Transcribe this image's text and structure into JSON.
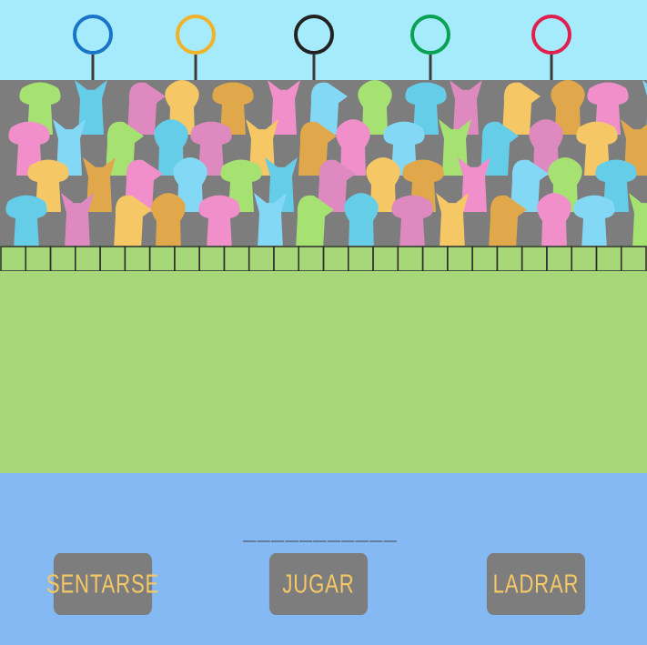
{
  "colors": {
    "sky": "#a6ebfb",
    "stands": "#7d7d7d",
    "field": "#a6d779",
    "water": "#84b9f4",
    "rail_stroke": "#2c2c2c",
    "button_bg": "#7d7d7d",
    "button_text": "#f6c765",
    "dogs": [
      "#a5e272",
      "#f08fca",
      "#f6c765",
      "#66cde9",
      "#83d9f5",
      "#e0a84a",
      "#de8ac0"
    ]
  },
  "rings": [
    {
      "color": "#1a74c7"
    },
    {
      "color": "#f0b229"
    },
    {
      "color": "#222222"
    },
    {
      "color": "#09a153"
    },
    {
      "color": "#e01f4f"
    }
  ],
  "answer_blank": "___________",
  "buttons": [
    {
      "label": "SENTARSE"
    },
    {
      "label": "JUGAR"
    },
    {
      "label": "LADRAR"
    }
  ]
}
